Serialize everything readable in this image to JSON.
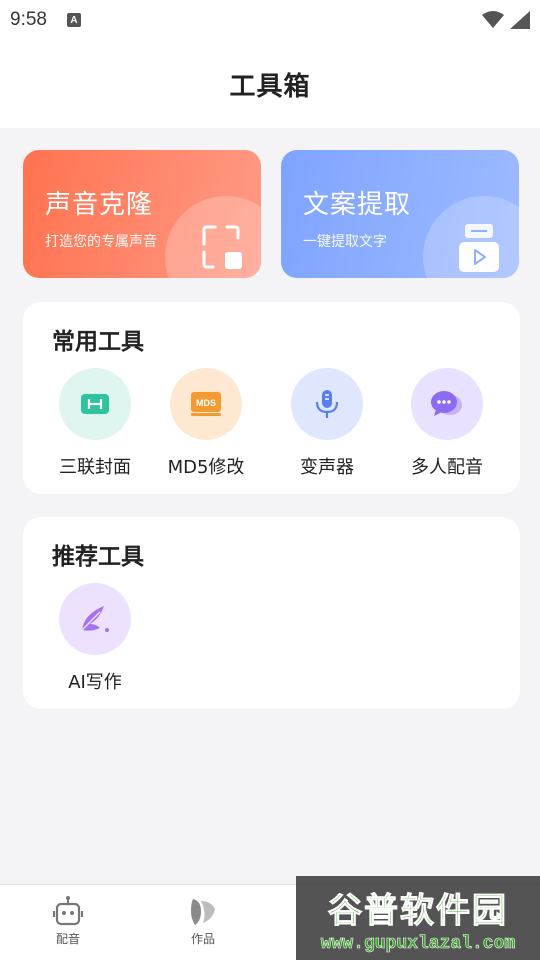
{
  "status_bar": {
    "time": "9:58",
    "notification_badge": "A",
    "icons": [
      "wifi-icon",
      "signal-icon"
    ]
  },
  "header": {
    "title": "工具箱"
  },
  "feature_cards": [
    {
      "title": "声音克隆",
      "subtitle": "打造您的专属声音",
      "icon": "scan-icon",
      "color_from": "#ff7350",
      "color_to": "#ff9a86"
    },
    {
      "title": "文案提取",
      "subtitle": "一键提取文字",
      "icon": "video-extract-icon",
      "color_from": "#7fa4ff",
      "color_to": "#9cbaff"
    }
  ],
  "common_tools": {
    "title": "常用工具",
    "items": [
      {
        "label": "三联封面",
        "icon": "triple-cover-icon",
        "bg": "#dff5ef",
        "fg": "#2ec4a0"
      },
      {
        "label": "MD5修改",
        "icon": "md5-icon",
        "bg": "#ffe8d2",
        "fg": "#f39a32"
      },
      {
        "label": "变声器",
        "icon": "microphone-icon",
        "bg": "#dfe7ff",
        "fg": "#5a7cf2"
      },
      {
        "label": "多人配音",
        "icon": "chat-bubble-icon",
        "bg": "#e8e1ff",
        "fg": "#8b6cf0"
      }
    ]
  },
  "recommended_tools": {
    "title": "推荐工具",
    "items": [
      {
        "label": "AI写作",
        "icon": "quill-icon",
        "bg": "#ece2ff",
        "fg": "#a673f0"
      }
    ]
  },
  "tab_bar": {
    "items": [
      {
        "label": "配音",
        "icon": "robot-icon"
      },
      {
        "label": "作品",
        "icon": "works-icon"
      }
    ]
  },
  "watermark": {
    "title": "谷普软件园",
    "url": "www.gupuxlazal.com"
  }
}
